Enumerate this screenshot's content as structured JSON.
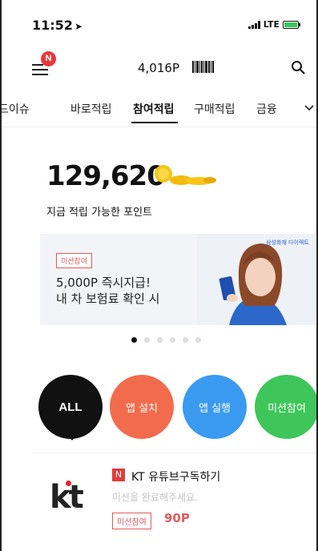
{
  "status_bar": {
    "time": "11:52",
    "network": "LTE",
    "icons": [
      "location-arrow-icon",
      "signal-icon",
      "battery-charging-icon"
    ]
  },
  "top_bar": {
    "menu_badge": "N",
    "points": "4,016P",
    "icons": [
      "menu-icon",
      "barcode-icon",
      "search-icon"
    ]
  },
  "tabs": {
    "items": [
      "핫이슈",
      "바로적립",
      "참여적립",
      "구매적립",
      "금융"
    ],
    "visible_first": "드이슈",
    "active": "참여적립"
  },
  "points_summary": {
    "amount": "129,620",
    "caption": "지금 적립 가능한 포인트"
  },
  "banner": {
    "badge": "미션참여",
    "line1": "5,000P 즉시지급!",
    "line2": "내 차 보험료 확인 시",
    "brand": "삼성화재 다이렉트",
    "dots_total": 6,
    "dots_active_index": 0
  },
  "categories": {
    "all": "ALL",
    "install": "앱 설치",
    "run": "앱 실행",
    "mission": "미션참여"
  },
  "list": {
    "items": [
      {
        "logo": "kt",
        "badge_icon": "N",
        "title": "KT 유튜브구독하기",
        "subtitle": "미션을 완료해주세요.",
        "type": "미션참여",
        "reward": "90P"
      }
    ]
  },
  "colors": {
    "accent_red": "#e35a5a",
    "install_orange": "#f26b4d",
    "run_blue": "#3a9af0",
    "mission_green": "#3fc65a",
    "coin_gold": "#f5c518"
  }
}
